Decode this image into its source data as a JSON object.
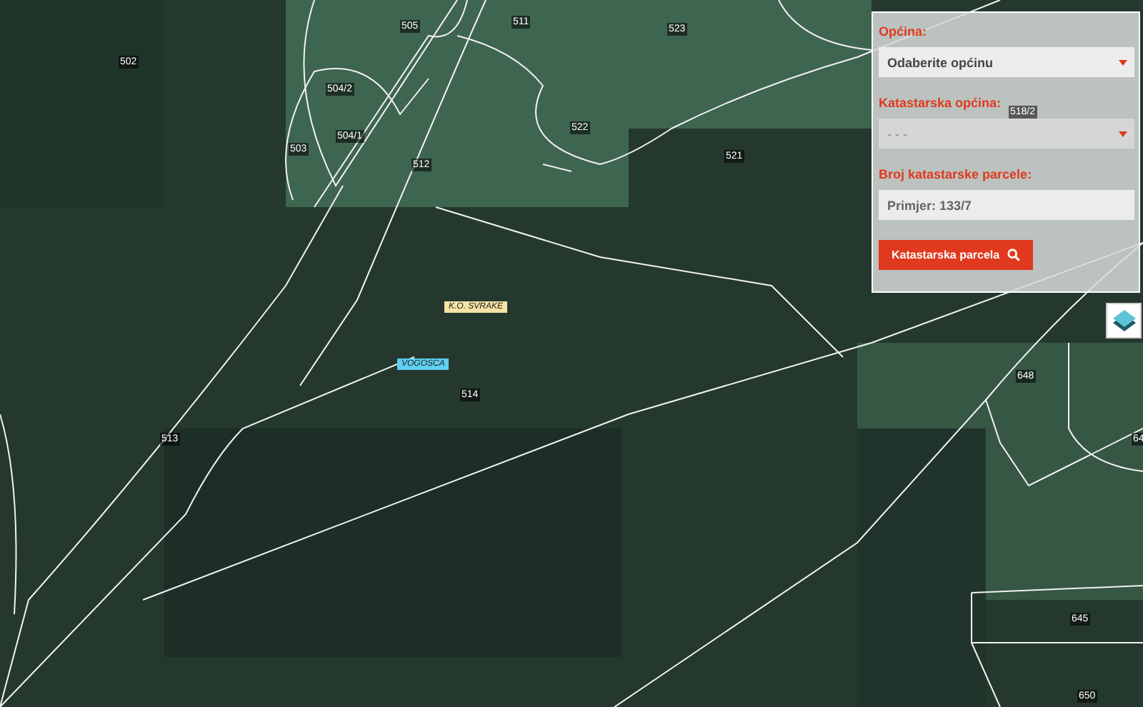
{
  "map": {
    "parcels": [
      "505",
      "511",
      "523",
      "502",
      "504/2",
      "504/1",
      "503",
      "512",
      "522",
      "521",
      "518/2",
      "514",
      "513",
      "648",
      "64",
      "645",
      "650"
    ],
    "place_labels": [
      {
        "text": "K.O. SVRAKE",
        "color": "#f7e3a6"
      },
      {
        "text": "VOGOSCA",
        "color": "#5ed0f2"
      }
    ]
  },
  "search_panel": {
    "municipality": {
      "label": "Općina:",
      "value": "Odaberite općinu"
    },
    "cadastral_municipality": {
      "label": "Katastarska općina:",
      "value": "- - -",
      "disabled": true
    },
    "parcel_number": {
      "label": "Broj katastarske parcele:",
      "placeholder": "Primjer: 133/7"
    },
    "button": "Katastarska parcela"
  }
}
